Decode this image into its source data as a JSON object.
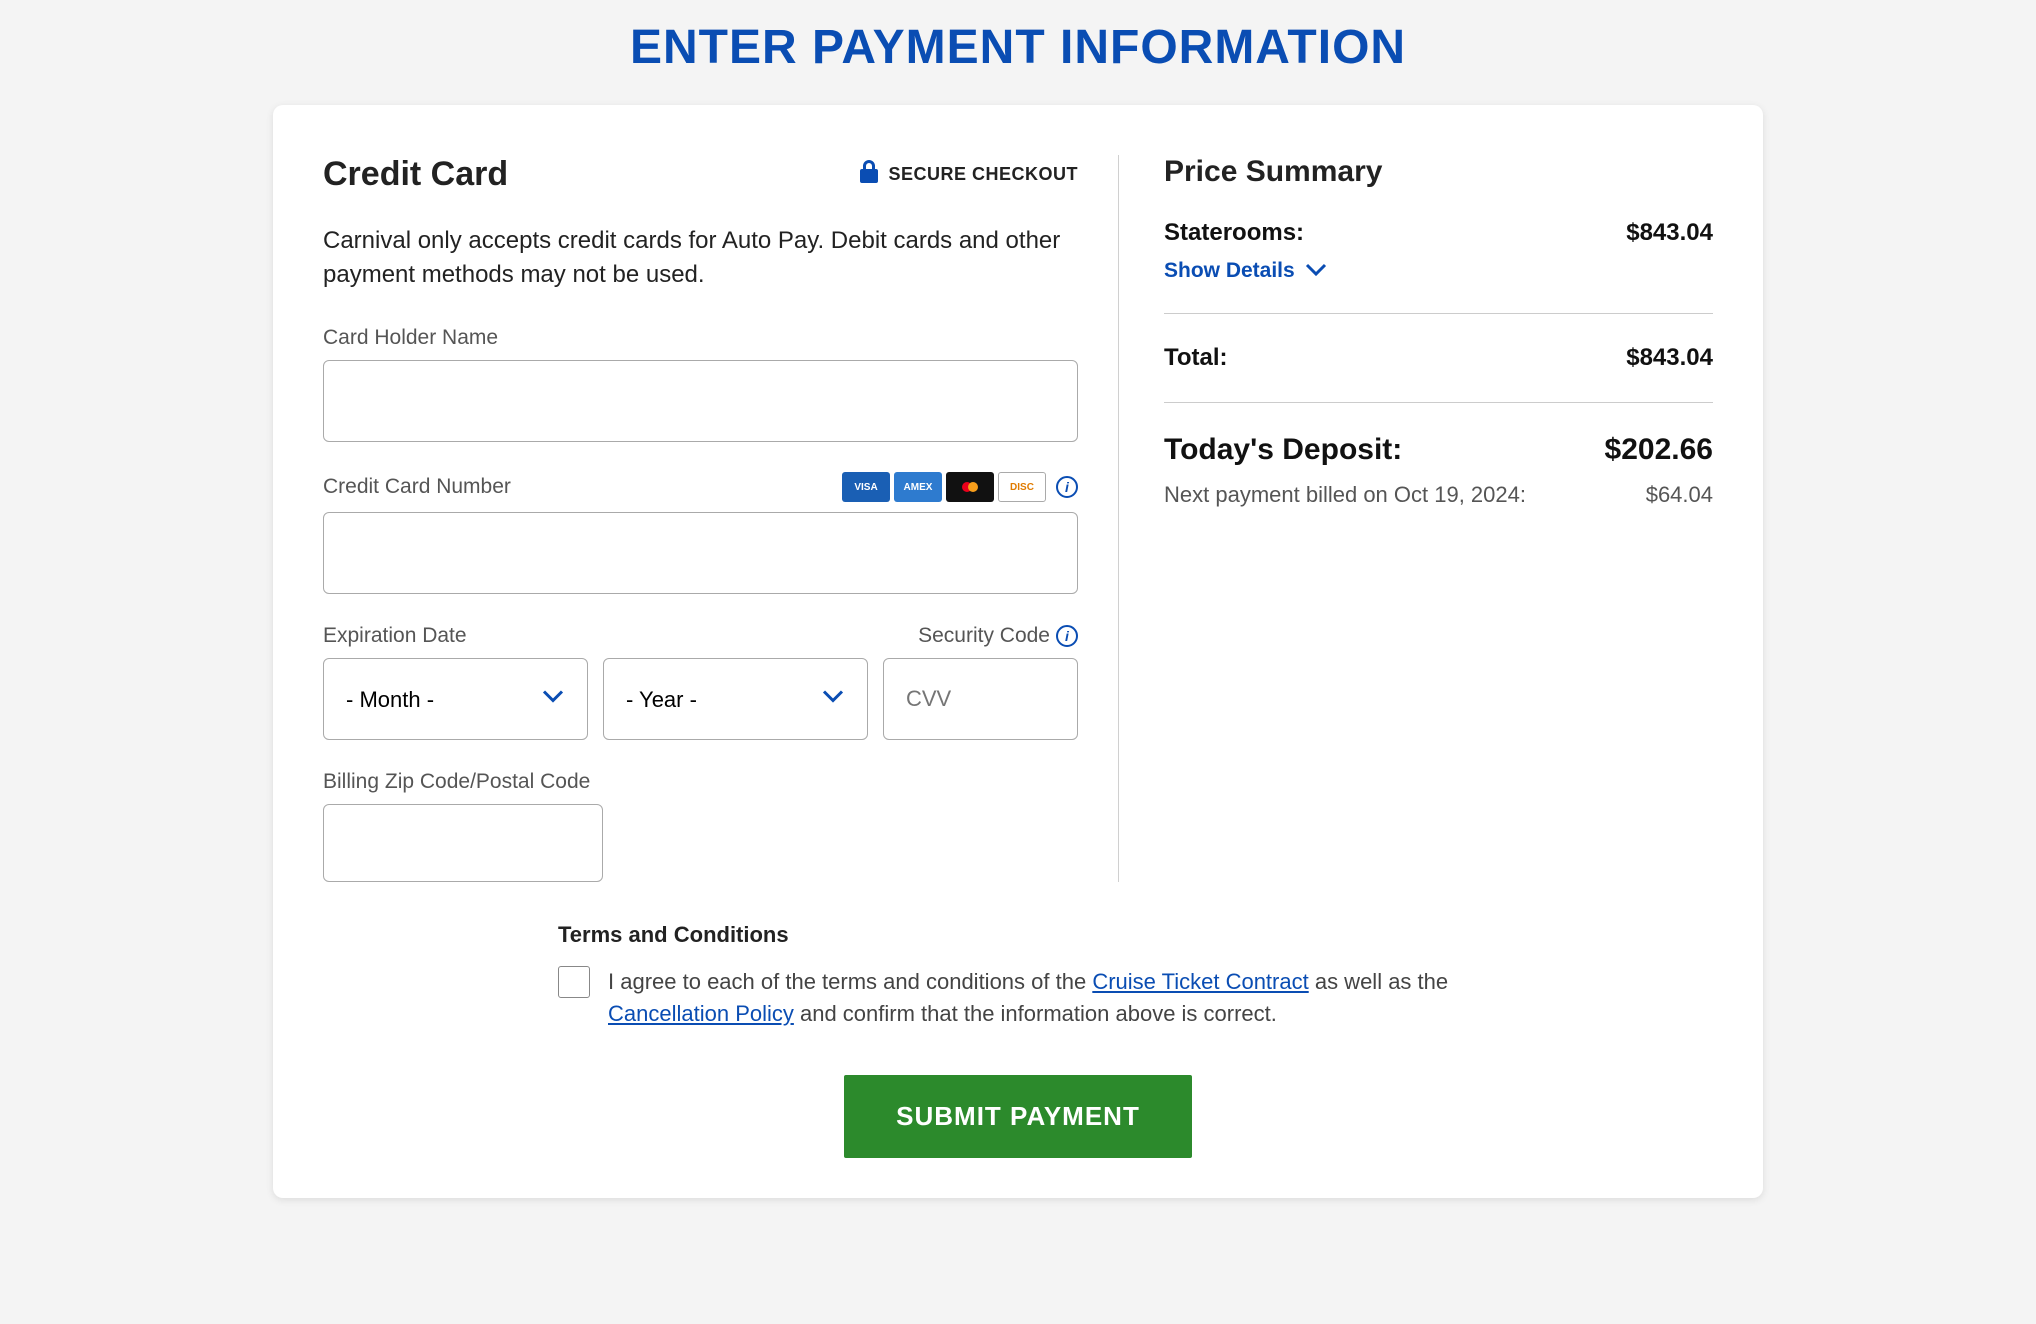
{
  "page": {
    "title": "ENTER PAYMENT INFORMATION"
  },
  "creditCard": {
    "heading": "Credit Card",
    "secureLabel": "SECURE CHECKOUT",
    "notice": "Carnival only accepts credit cards for Auto Pay. Debit cards and other payment methods may not be used.",
    "labels": {
      "cardHolder": "Card Holder Name",
      "cardNumber": "Credit Card Number",
      "expiration": "Expiration Date",
      "security": "Security Code",
      "zip": "Billing Zip Code/Postal Code"
    },
    "placeholders": {
      "month": "- Month -",
      "year": "- Year -",
      "cvv": "CVV"
    },
    "cardBrands": [
      "VISA",
      "AMEX",
      "MC",
      "DISCOVER"
    ]
  },
  "priceSummary": {
    "heading": "Price Summary",
    "stateroomsLabel": "Staterooms:",
    "stateroomsAmount": "$843.04",
    "showDetails": "Show Details",
    "totalLabel": "Total:",
    "totalAmount": "$843.04",
    "depositLabel": "Today's Deposit:",
    "depositAmount": "$202.66",
    "nextPaymentLabel": "Next payment billed on Oct 19, 2024:",
    "nextPaymentAmount": "$64.04"
  },
  "terms": {
    "heading": "Terms and Conditions",
    "text1": "I agree to each of the terms and conditions of the ",
    "link1": "Cruise Ticket Contract",
    "text2": " as well as the ",
    "link2": "Cancellation Policy",
    "text3": " and confirm that the information above is correct."
  },
  "submit": {
    "label": "SUBMIT PAYMENT"
  }
}
